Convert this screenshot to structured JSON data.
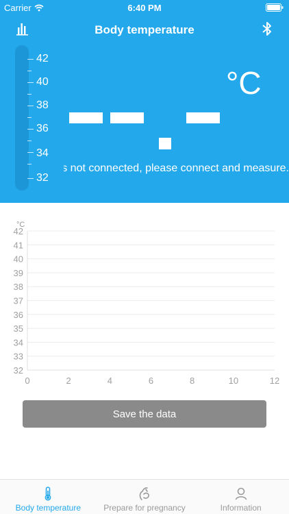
{
  "status_bar": {
    "carrier": "Carrier",
    "time": "6:40 PM",
    "icons": [
      "wifi-icon",
      "battery-icon"
    ]
  },
  "nav": {
    "title": "Body temperature",
    "left_icon": "bar-chart-icon",
    "right_icon": "bluetooth-icon"
  },
  "thermometer": {
    "scale_labels": [
      "42",
      "40",
      "38",
      "36",
      "34",
      "32"
    ]
  },
  "display": {
    "reading": "--.-",
    "unit": "°C",
    "message": "Bluetooth is not connected, please connect and measure."
  },
  "chart_data": {
    "type": "line",
    "ylabel": "°C",
    "xlabel": "",
    "x": [],
    "y": [],
    "xlim": [
      0,
      12
    ],
    "ylim": [
      32,
      42
    ],
    "x_ticks": [
      "0",
      "2",
      "4",
      "6",
      "8",
      "10",
      "12"
    ],
    "y_ticks": [
      "42",
      "41",
      "40",
      "39",
      "38",
      "37",
      "36",
      "35",
      "34",
      "33",
      "32"
    ],
    "grid": true
  },
  "save_button": {
    "label": "Save the data"
  },
  "tabs": [
    {
      "label": "Body temperature",
      "icon": "thermometer-icon",
      "active": true
    },
    {
      "label": "Prepare for pregnancy",
      "icon": "pregnancy-icon",
      "active": false
    },
    {
      "label": "Information",
      "icon": "person-icon",
      "active": false
    }
  ],
  "colors": {
    "primary": "#23a8ec",
    "thermo_track": "#1d96d8",
    "button": "#8a8a8a",
    "tab_inactive": "#9a9a9a"
  }
}
